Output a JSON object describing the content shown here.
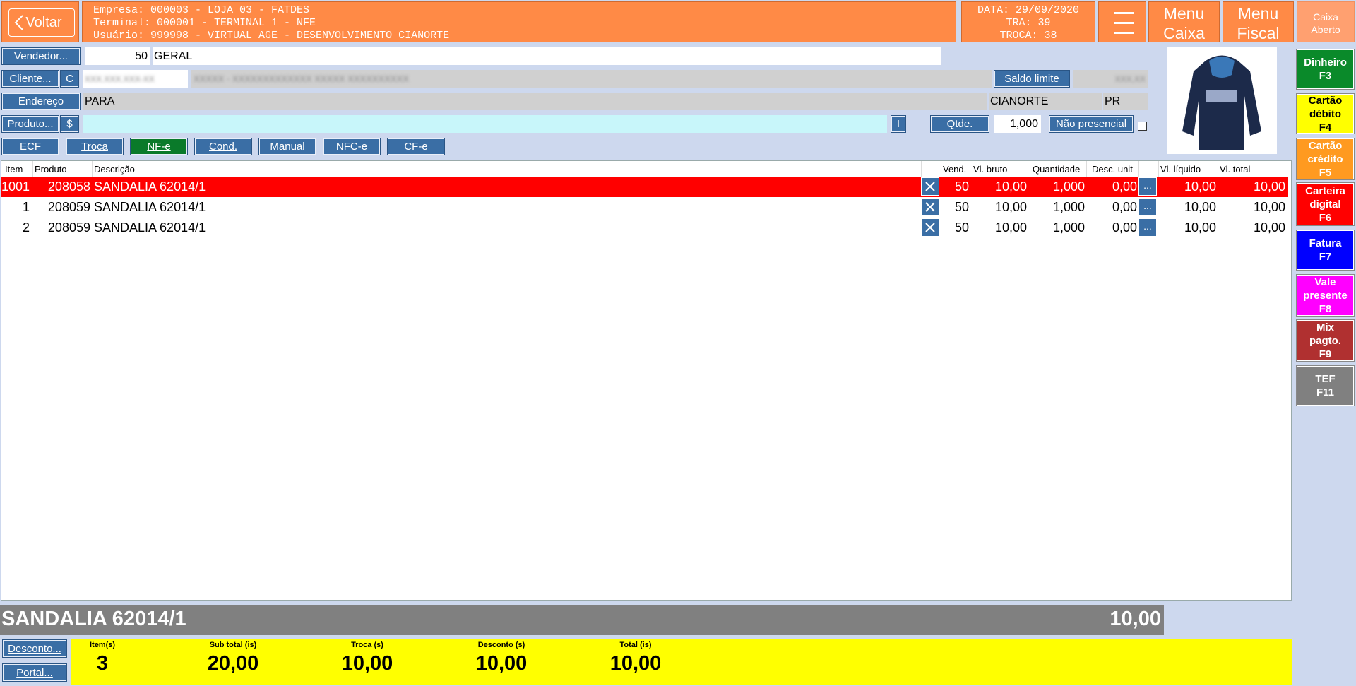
{
  "header": {
    "back_label": "Voltar",
    "info_line1": "Empresa: 000003 - LOJA 03 - FATDES",
    "info_line2": "Terminal: 000001 - TERMINAL 1 - NFE",
    "info_line3": "Usuário: 999998 - VIRTUAL AGE - DESENVOLVIMENTO CIANORTE",
    "date_line": "DATA: 29/09/2020",
    "tra_line": "TRA: 39",
    "troca_line": "TROCA: 38",
    "menu_caixa_1": "Menu",
    "menu_caixa_2": "Caixa",
    "menu_fiscal_1": "Menu",
    "menu_fiscal_2": "Fiscal",
    "caixa_status_1": "Caixa",
    "caixa_status_2": "Aberto"
  },
  "form": {
    "vendedor_label": "Vendedor...",
    "vendedor_code": "50",
    "vendedor_name": "GERAL",
    "cliente_label": "Cliente...",
    "cliente_c": "C",
    "cliente_code": "XXX.XXX.XXX-XX",
    "cliente_name": "XXXXX - XXXXXXXXXXXXX XXXXX XXXXXXXXXX",
    "saldo_label": "Saldo limite",
    "saldo_value": "XXX,XX",
    "endereco_label": "Endereço",
    "endereco_value": "PARA",
    "cidade": "CIANORTE",
    "uf": "PR",
    "produto_label": "Produto...",
    "produto_dollar": "$",
    "produto_value": "",
    "i_label": "I",
    "qtde_label": "Qtde.",
    "qtde_value": "1,000",
    "nao_presencial_label": "Não presencial"
  },
  "modes": {
    "ecf": "ECF",
    "troca": "Troca",
    "nfe": "NF-e",
    "cond": "Cond.",
    "manual": "Manual",
    "nfce": "NFC-e",
    "cfe": "CF-e"
  },
  "table": {
    "headers": {
      "item": "Item",
      "produto": "Produto",
      "descricao": "Descrição",
      "vend": "Vend.",
      "vl_bruto": "Vl. bruto",
      "quantidade": "Quantidade",
      "desc_unit": "Desc. unit",
      "vl_liquido": "Vl. líquido",
      "vl_total": "Vl. total"
    },
    "rows": [
      {
        "item": "1001",
        "produto": "208058",
        "descricao": "SANDALIA 62014/1",
        "vend": "50",
        "vl_bruto": "10,00",
        "quantidade": "1,000",
        "desc_unit": "0,00",
        "vl_liquido": "10,00",
        "vl_total": "10,00",
        "dots": "..."
      },
      {
        "item": "1",
        "produto": "208059",
        "descricao": "SANDALIA 62014/1",
        "vend": "50",
        "vl_bruto": "10,00",
        "quantidade": "1,000",
        "desc_unit": "0,00",
        "vl_liquido": "10,00",
        "vl_total": "10,00",
        "dots": "..."
      },
      {
        "item": "2",
        "produto": "208059",
        "descricao": "SANDALIA 62014/1",
        "vend": "50",
        "vl_bruto": "10,00",
        "quantidade": "1,000",
        "desc_unit": "0,00",
        "vl_liquido": "10,00",
        "vl_total": "10,00",
        "dots": "..."
      }
    ]
  },
  "current_item": {
    "description": "SANDALIA 62014/1",
    "value": "10,00"
  },
  "bottom": {
    "desconto_label": "Desconto...",
    "portal_label": "Portal...",
    "items_label": "Item(s)",
    "items_value": "3",
    "subtotal_label": "Sub total (is)",
    "subtotal_value": "20,00",
    "troca_label": "Troca (s)",
    "troca_value": "10,00",
    "desconto_tot_label": "Desconto (s)",
    "desconto_tot_value": "10,00",
    "total_label": "Total (is)",
    "total_value": "10,00"
  },
  "payments": [
    {
      "line1": "Dinheiro",
      "line2": "F3",
      "line3": "",
      "bg": "#0a8a2a",
      "fg": "#ffffff"
    },
    {
      "line1": "Cartão",
      "line2": "débito",
      "line3": "F4",
      "bg": "#ffff00",
      "fg": "#000000"
    },
    {
      "line1": "Cartão",
      "line2": "crédito",
      "line3": "F5",
      "bg": "#ff9a20",
      "fg": "#ffffff"
    },
    {
      "line1": "Carteira",
      "line2": "digital",
      "line3": "F6",
      "bg": "#ff0000",
      "fg": "#ffffff"
    },
    {
      "line1": "Fatura",
      "line2": "F7",
      "line3": "",
      "bg": "#0000ff",
      "fg": "#ffffff"
    },
    {
      "line1": "Vale",
      "line2": "presente",
      "line3": "F8",
      "bg": "#ff00ff",
      "fg": "#ffffff"
    },
    {
      "line1": "Mix",
      "line2": "pagto.",
      "line3": "F9",
      "bg": "#b03030",
      "fg": "#ffffff"
    },
    {
      "line1": "TEF",
      "line2": "F11",
      "line3": "",
      "bg": "#808080",
      "fg": "#ffffff"
    }
  ],
  "colors": {
    "background": "#cdd8ee",
    "header_orange": "#ff8a46",
    "button_blue": "#3a6ea5",
    "selected_row": "#ff0000",
    "totals_yellow": "#ffff00"
  }
}
